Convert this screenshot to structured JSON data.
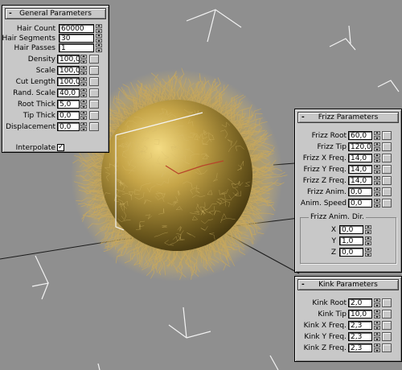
{
  "general_parameters": {
    "title": "General Parameters",
    "collapse_symbol": "-",
    "params": [
      {
        "label": "Hair Count",
        "value": "60000"
      },
      {
        "label": "Hair Segments",
        "value": "30"
      },
      {
        "label": "Hair Passes",
        "value": "1"
      },
      {
        "label": "Density",
        "value": "100,0"
      },
      {
        "label": "Scale",
        "value": "100,0"
      },
      {
        "label": "Cut Length",
        "value": "100,0"
      },
      {
        "label": "Rand. Scale",
        "value": "40,0"
      },
      {
        "label": "Root Thick",
        "value": "5,0"
      },
      {
        "label": "Tip Thick",
        "value": "0,0"
      },
      {
        "label": "Displacement",
        "value": "0,0"
      }
    ],
    "interpolate": {
      "label": "Interpolate",
      "checked": true,
      "check_symbol": "✓"
    }
  },
  "frizz_parameters": {
    "title": "Frizz Parameters",
    "collapse_symbol": "-",
    "params": [
      {
        "label": "Frizz Root",
        "value": "60,0"
      },
      {
        "label": "Frizz Tip",
        "value": "120,0"
      },
      {
        "label": "Frizz X Freq.",
        "value": "14,0"
      },
      {
        "label": "Frizz Y Freq.",
        "value": "14,0"
      },
      {
        "label": "Frizz Z Freq.",
        "value": "14,0"
      },
      {
        "label": "Frizz Anim.",
        "value": "0,0"
      },
      {
        "label": "Anim. Speed",
        "value": "0,0"
      }
    ],
    "anim_dir": {
      "title": "Frizz Anim. Dir.",
      "params": [
        {
          "label": "X",
          "value": "0,0"
        },
        {
          "label": "Y",
          "value": "1,0"
        },
        {
          "label": "Z",
          "value": "0,0"
        }
      ]
    }
  },
  "kink_parameters": {
    "title": "Kink Parameters",
    "collapse_symbol": "-",
    "params": [
      {
        "label": "Kink Root",
        "value": "2,0"
      },
      {
        "label": "Kink Tip",
        "value": "10,0"
      },
      {
        "label": "Kink X Freq.",
        "value": "2,3"
      },
      {
        "label": "Kink Y Freq.",
        "value": "2,3"
      },
      {
        "label": "Kink Z Freq.",
        "value": "2,3"
      }
    ]
  },
  "viewport": {
    "background_color": "#8f8f8f",
    "sphere_color": "#a88f3a",
    "hair_color": "#c9a85a"
  }
}
